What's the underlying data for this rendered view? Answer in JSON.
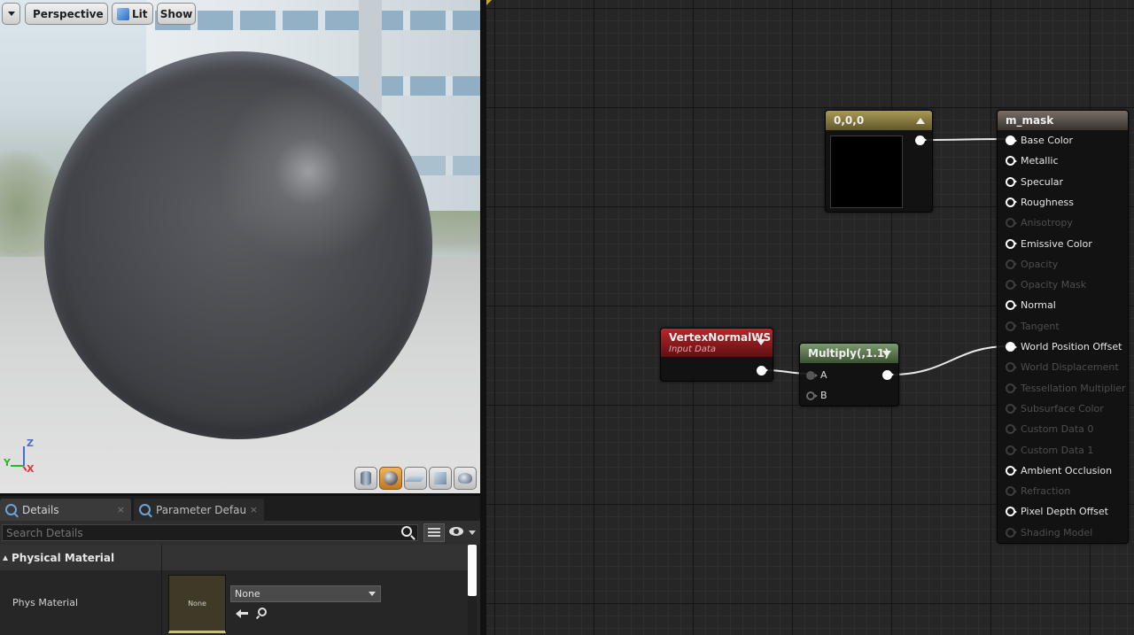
{
  "viewport": {
    "view_mode": "Perspective",
    "lighting": "Lit",
    "show_label": "Show",
    "axes": {
      "x": "X",
      "y": "Y",
      "z": "Z"
    },
    "preview_shapes": [
      "cylinder",
      "sphere",
      "plane",
      "cube",
      "teapot"
    ],
    "active_shape": "sphere"
  },
  "details": {
    "tabs": [
      {
        "label": "Details",
        "close": "×"
      },
      {
        "label": "Parameter Defaults",
        "close": "×"
      }
    ],
    "search_placeholder": "Search Details",
    "category": "Physical Material",
    "property_label": "Phys Material",
    "thumbnail_label": "None",
    "selected_value": "None"
  },
  "graph": {
    "nodes": {
      "constant": {
        "title": "0,0,0",
        "preview_color": "#000000"
      },
      "vertex_normal": {
        "title": "VertexNormalWS",
        "subtitle": "Input Data"
      },
      "multiply": {
        "title": "Multiply(,1.1)",
        "inputs": [
          "A",
          "B"
        ]
      },
      "material": {
        "title": "m_mask",
        "pins": [
          {
            "label": "Base Color",
            "enabled": true,
            "connected": true
          },
          {
            "label": "Metallic",
            "enabled": true,
            "connected": false
          },
          {
            "label": "Specular",
            "enabled": true,
            "connected": false
          },
          {
            "label": "Roughness",
            "enabled": true,
            "connected": false
          },
          {
            "label": "Anisotropy",
            "enabled": false,
            "connected": false
          },
          {
            "label": "Emissive Color",
            "enabled": true,
            "connected": false
          },
          {
            "label": "Opacity",
            "enabled": false,
            "connected": false
          },
          {
            "label": "Opacity Mask",
            "enabled": false,
            "connected": false
          },
          {
            "label": "Normal",
            "enabled": true,
            "connected": false
          },
          {
            "label": "Tangent",
            "enabled": false,
            "connected": false
          },
          {
            "label": "World Position Offset",
            "enabled": true,
            "connected": true
          },
          {
            "label": "World Displacement",
            "enabled": false,
            "connected": false
          },
          {
            "label": "Tessellation Multiplier",
            "enabled": false,
            "connected": false
          },
          {
            "label": "Subsurface Color",
            "enabled": false,
            "connected": false
          },
          {
            "label": "Custom Data 0",
            "enabled": false,
            "connected": false
          },
          {
            "label": "Custom Data 1",
            "enabled": false,
            "connected": false
          },
          {
            "label": "Ambient Occlusion",
            "enabled": true,
            "connected": false
          },
          {
            "label": "Refraction",
            "enabled": false,
            "connected": false
          },
          {
            "label": "Pixel Depth Offset",
            "enabled": true,
            "connected": false
          },
          {
            "label": "Shading Model",
            "enabled": false,
            "connected": false
          }
        ]
      }
    }
  }
}
